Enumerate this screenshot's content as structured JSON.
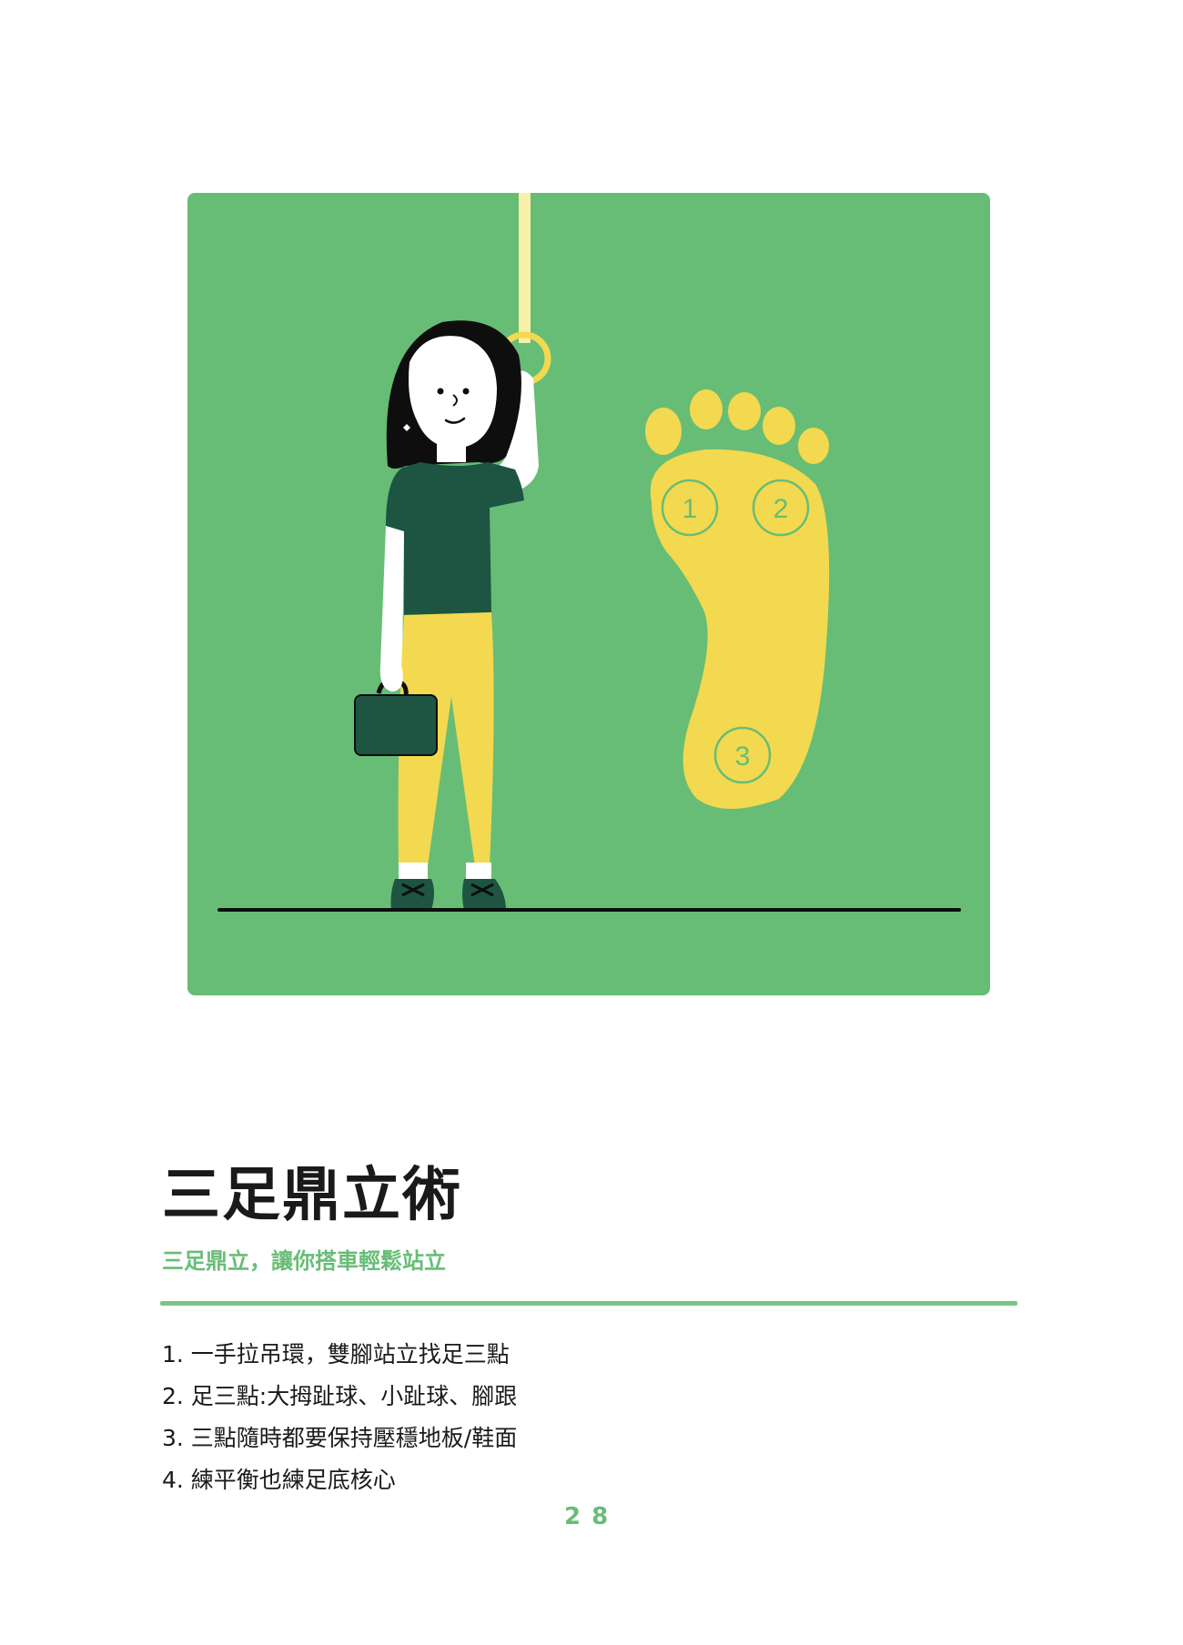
{
  "title": "三足鼎立術",
  "subtitle": "三足鼎立，讓你搭車輕鬆站立",
  "steps": [
    "1. 一手拉吊環，雙腳站立找足三點",
    "2. 足三點:大拇趾球、小趾球、腳跟",
    "3. 三點隨時都要保持壓穩地板/鞋面",
    "4. 練平衡也練足底核心"
  ],
  "illustration": {
    "foot_points": [
      "1",
      "2",
      "3"
    ]
  },
  "page_number": "28",
  "colors": {
    "accent_green": "#67bd76",
    "foot_yellow": "#f3d94f",
    "shirt_dark_green": "#1d5442",
    "text_dark": "#1a1a1a"
  }
}
